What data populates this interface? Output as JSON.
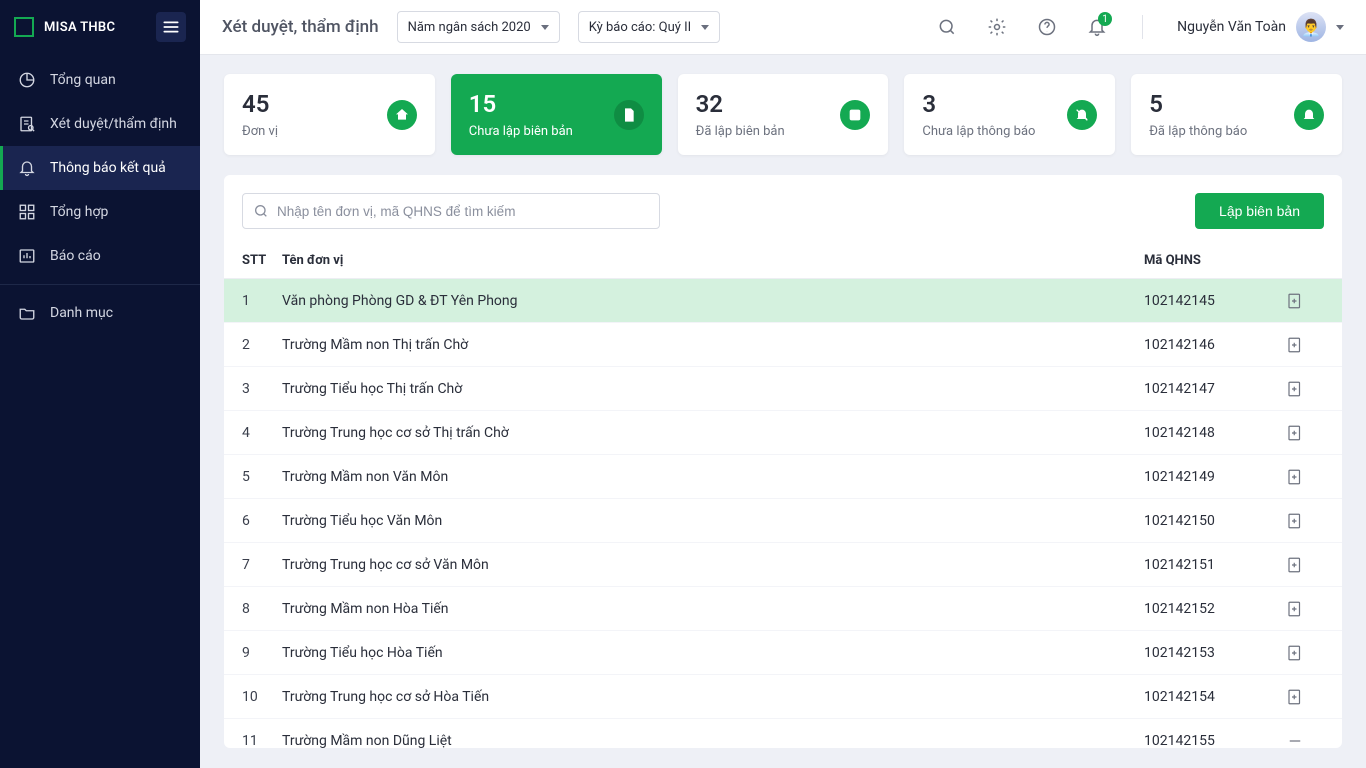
{
  "app": {
    "name": "MISA THBC"
  },
  "user": {
    "name": "Nguyễn Văn Toàn",
    "notification_count": "1"
  },
  "page": {
    "title": "Xét duyệt, thẩm định"
  },
  "filters": {
    "budget_year": "Năm ngân sách 2020",
    "report_period": "Kỳ báo cáo: Quý II"
  },
  "sidebar": {
    "items": [
      {
        "label": "Tổng quan"
      },
      {
        "label": "Xét duyệt/thẩm định"
      },
      {
        "label": "Thông báo kết quả"
      },
      {
        "label": "Tổng hợp"
      },
      {
        "label": "Báo cáo"
      },
      {
        "label": "Danh mục"
      }
    ]
  },
  "cards": [
    {
      "num": "45",
      "sub": "Đơn vị"
    },
    {
      "num": "15",
      "sub": "Chưa lập biên bản"
    },
    {
      "num": "32",
      "sub": "Đã lập biên bản"
    },
    {
      "num": "3",
      "sub": "Chưa lập thông báo"
    },
    {
      "num": "5",
      "sub": "Đã lập thông báo"
    }
  ],
  "panel": {
    "search_placeholder": "Nhập tên đơn vị, mã QHNS để tìm kiếm",
    "primary_btn": "Lập biên bản",
    "columns": {
      "stt": "STT",
      "name": "Tên đơn vị",
      "code": "Mã QHNS"
    },
    "rows": [
      {
        "stt": "1",
        "name": "Văn phòng Phòng GD & ĐT Yên Phong",
        "code": "102142145"
      },
      {
        "stt": "2",
        "name": "Trường Mầm non Thị trấn Chờ",
        "code": "102142146"
      },
      {
        "stt": "3",
        "name": "Trường Tiểu học Thị trấn Chờ",
        "code": "102142147"
      },
      {
        "stt": "4",
        "name": "Trường Trung học cơ sở Thị trấn Chờ",
        "code": "102142148"
      },
      {
        "stt": "5",
        "name": "Trường Mầm non Văn Môn",
        "code": "102142149"
      },
      {
        "stt": "6",
        "name": "Trường Tiểu học Văn Môn",
        "code": "102142150"
      },
      {
        "stt": "7",
        "name": "Trường Trung học cơ sở Văn Môn",
        "code": "102142151"
      },
      {
        "stt": "8",
        "name": "Trường Mầm non Hòa Tiến",
        "code": "102142152"
      },
      {
        "stt": "9",
        "name": "Trường Tiểu học Hòa Tiến",
        "code": "102142153"
      },
      {
        "stt": "10",
        "name": "Trường Trung học cơ sở Hòa Tiến",
        "code": "102142154"
      },
      {
        "stt": "11",
        "name": "Trường Mầm non Dũng Liệt",
        "code": "102142155"
      }
    ]
  }
}
